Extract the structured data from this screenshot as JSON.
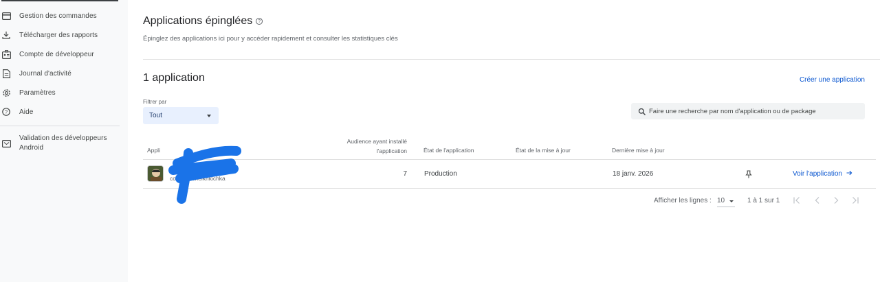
{
  "sidebar": {
    "items": [
      {
        "label": "Gestion des commandes",
        "icon": "credit-card-icon"
      },
      {
        "label": "Télécharger des rapports",
        "icon": "download-icon"
      },
      {
        "label": "Compte de développeur",
        "icon": "developer-account-icon"
      },
      {
        "label": "Journal d'activité",
        "icon": "document-icon"
      },
      {
        "label": "Paramètres",
        "icon": "gear-icon"
      },
      {
        "label": "Aide",
        "icon": "help-icon"
      },
      {
        "label": "Validation des développeurs Android",
        "icon": "verification-icon"
      }
    ]
  },
  "pinned": {
    "title": "Applications épinglées",
    "subtitle": "Épinglez des applications ici pour y accéder rapidement et consulter les statistiques clés"
  },
  "apps": {
    "count_title": "1 application",
    "create_link": "Créer une application",
    "filter": {
      "label": "Filtrer par",
      "value": "Tout"
    },
    "search": {
      "placeholder": "Faire une recherche par nom d'application ou de package"
    },
    "columns": {
      "app": "Appli",
      "audience": "Audience ayant installé l'application",
      "state": "État de l'application",
      "update_state": "État de la mise à jour",
      "last_update": "Dernière mise à jour"
    },
    "rows": [
      {
        "package": "com          nid.cheikhkichka",
        "audience": "7",
        "state": "Production",
        "update_state": "",
        "last_update": "18 janv. 2026",
        "view_link": "Voir l'application"
      }
    ],
    "pagination": {
      "rows_label": "Afficher les lignes :",
      "rows_value": "10",
      "range": "1 à 1 sur 1"
    }
  },
  "colors": {
    "accent": "#0b57d0",
    "sidebar_bg": "#f8f9fa",
    "select_bg": "#e8f0fe",
    "redaction": "#1a73e8"
  }
}
